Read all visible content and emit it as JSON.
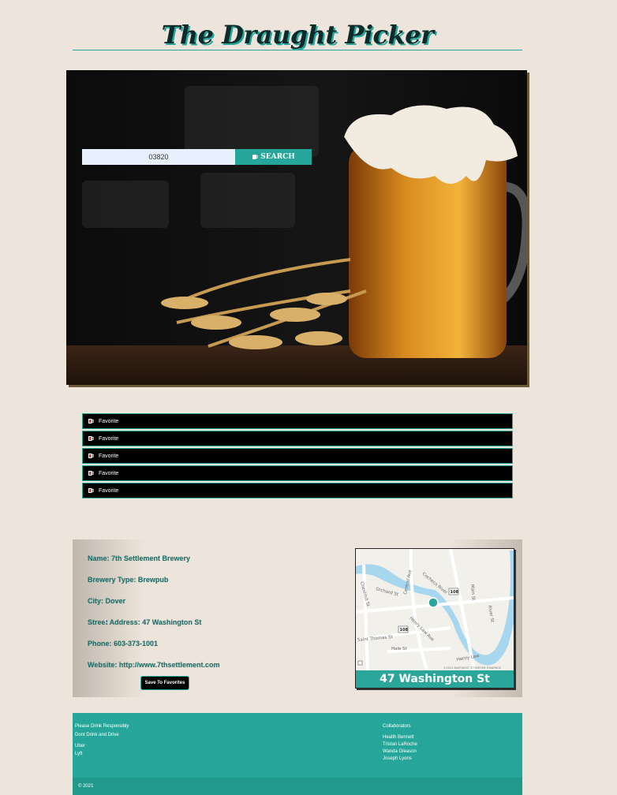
{
  "header": {
    "title": "The Draught Picker"
  },
  "search": {
    "value": "03820",
    "button_label": "SEARCH"
  },
  "favorites": {
    "items": [
      {
        "label": "Favorite"
      },
      {
        "label": "Favorite"
      },
      {
        "label": "Favorite"
      },
      {
        "label": "Favorite"
      },
      {
        "label": "Favorite"
      }
    ]
  },
  "brewery": {
    "name": "Name: 7th Settlement Brewery",
    "type": "Brewery Type: Brewpub",
    "city": "City: Dover",
    "street": "Street Address: 47 Washington St",
    "phone": "Phone: 603-373-1001",
    "website": "Website: http://www.7thsettlement.com",
    "save_label": "Save To Favorites"
  },
  "map": {
    "caption": "47 Washington St",
    "street_labels": [
      "Central Ave",
      "Cocheco River",
      "Orchard St",
      "Chestnut St",
      "Saint Thomas St",
      "Henry Law Ave",
      "Hale St",
      "Henry Law",
      "River St",
      "Main St"
    ],
    "route_shields": [
      "108",
      "108",
      "108"
    ],
    "credit": "©2021 MAPQUEST ©TOMTOM ©MAPBOX"
  },
  "footer": {
    "left": [
      "Please Drink Responsibly",
      "Dont Drink and Drive",
      "Uber",
      "Lyft"
    ],
    "collaborators_title": "Collaborators",
    "collaborators": [
      "Health Bennett",
      "Tristan LaRoche",
      "Wanda Gleason",
      "Joseph Lyons"
    ],
    "copyright": "© 2021"
  },
  "colors": {
    "accent": "#26a69a",
    "background": "#ede5db",
    "favorites_bg": "#000000"
  }
}
